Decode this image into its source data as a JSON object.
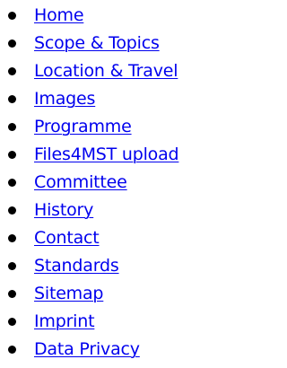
{
  "nav": {
    "link_color": "#0000EE",
    "items": [
      {
        "label": "Home"
      },
      {
        "label": "Scope & Topics"
      },
      {
        "label": "Location & Travel"
      },
      {
        "label": "Images"
      },
      {
        "label": "Programme"
      },
      {
        "label": "Files4MST upload"
      },
      {
        "label": "Committee"
      },
      {
        "label": "History"
      },
      {
        "label": "Contact"
      },
      {
        "label": "Standards"
      },
      {
        "label": "Sitemap"
      },
      {
        "label": "Imprint"
      },
      {
        "label": "Data Privacy"
      }
    ]
  }
}
